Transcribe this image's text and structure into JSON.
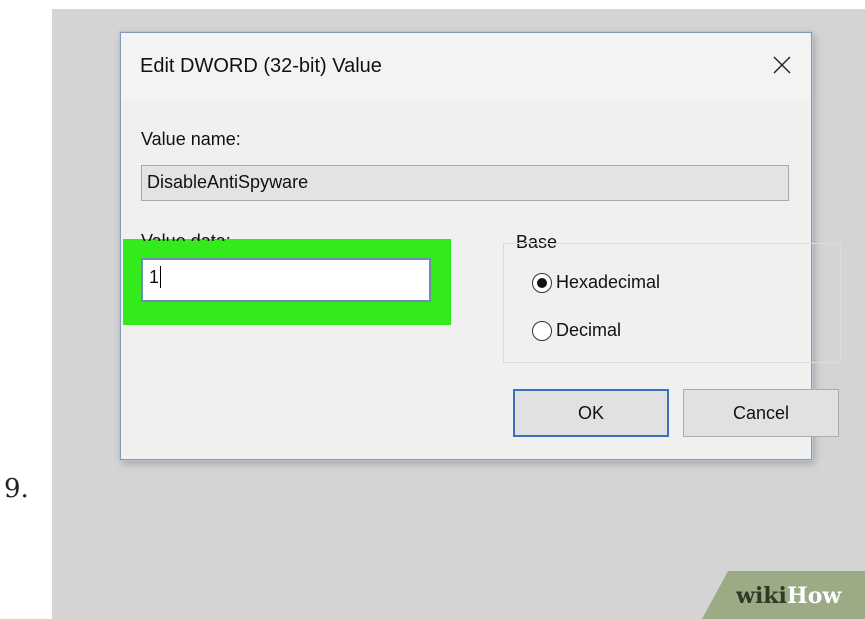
{
  "step": {
    "number": "9."
  },
  "dialog": {
    "title": "Edit DWORD (32-bit) Value",
    "value_name_label": "Value name:",
    "value_name": "DisableAntiSpyware",
    "value_data_label": "Value data:",
    "value_data": "1",
    "base_label": "Base",
    "base_options": [
      {
        "label": "Hexadecimal",
        "selected": true
      },
      {
        "label": "Decimal",
        "selected": false
      }
    ],
    "ok_label": "OK",
    "cancel_label": "Cancel"
  },
  "watermark": {
    "part1": "wiki",
    "part2": "How"
  },
  "colors": {
    "highlight": "#34ea1c",
    "dialog_border": "#7f9db9",
    "default_button_border": "#3c6fc0",
    "watermark_bg": "#9aab85"
  }
}
